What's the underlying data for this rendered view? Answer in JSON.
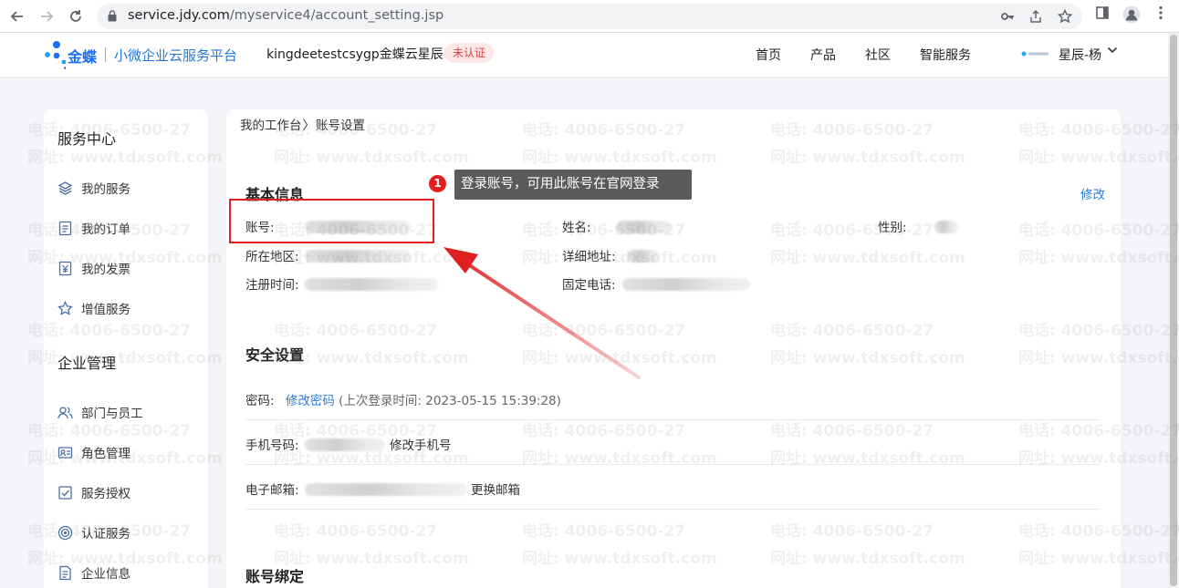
{
  "browser": {
    "url_domain": "service.jdy.com",
    "url_path": "/myservice4/account_setting.jsp"
  },
  "header": {
    "brand": "金蝶",
    "subtitle": "小微企业云服务平台",
    "company": "kingdeetestcsygp金蝶云星辰",
    "badge": "未认证",
    "nav": [
      "首页",
      "产品",
      "社区",
      "智能服务"
    ],
    "user": "星辰-杨"
  },
  "sidebar": {
    "section1": "服务中心",
    "section1_items": [
      "我的服务",
      "我的订单",
      "我的发票",
      "增值服务"
    ],
    "section2": "企业管理",
    "section2_items": [
      "部门与员工",
      "角色管理",
      "服务授权",
      "认证服务",
      "企业信息"
    ]
  },
  "breadcrumb": {
    "home": "我的工作台",
    "sep": "〉",
    "current": "账号设置"
  },
  "basic": {
    "title": "基本信息",
    "edit": "修改",
    "account_label": "账号:",
    "name_label": "姓名:",
    "gender_label": "性别:",
    "region_label": "所在地区:",
    "address_label": "详细地址:",
    "reg_time_label": "注册时间:",
    "phone_label": "固定电话:"
  },
  "security": {
    "title": "安全设置",
    "password_label": "密码:",
    "password_link": "修改密码",
    "last_login": "(上次登录时间: 2023-05-15 15:39:28)",
    "mobile_label": "手机号码:",
    "mobile_link": "修改手机号",
    "email_label": "电子邮箱:",
    "email_link": "更换邮箱"
  },
  "binding": {
    "title": "账号绑定"
  },
  "annotation": {
    "number": "1",
    "text": "登录账号，可用此账号在官网登录"
  },
  "watermark": {
    "line1": "电话: 4006-6500-27",
    "line2": "网址: www.tdxsoft.com"
  },
  "colors": {
    "brand": "#1a6ff4",
    "link": "#2e7cd6",
    "highlight": "#e02020"
  }
}
